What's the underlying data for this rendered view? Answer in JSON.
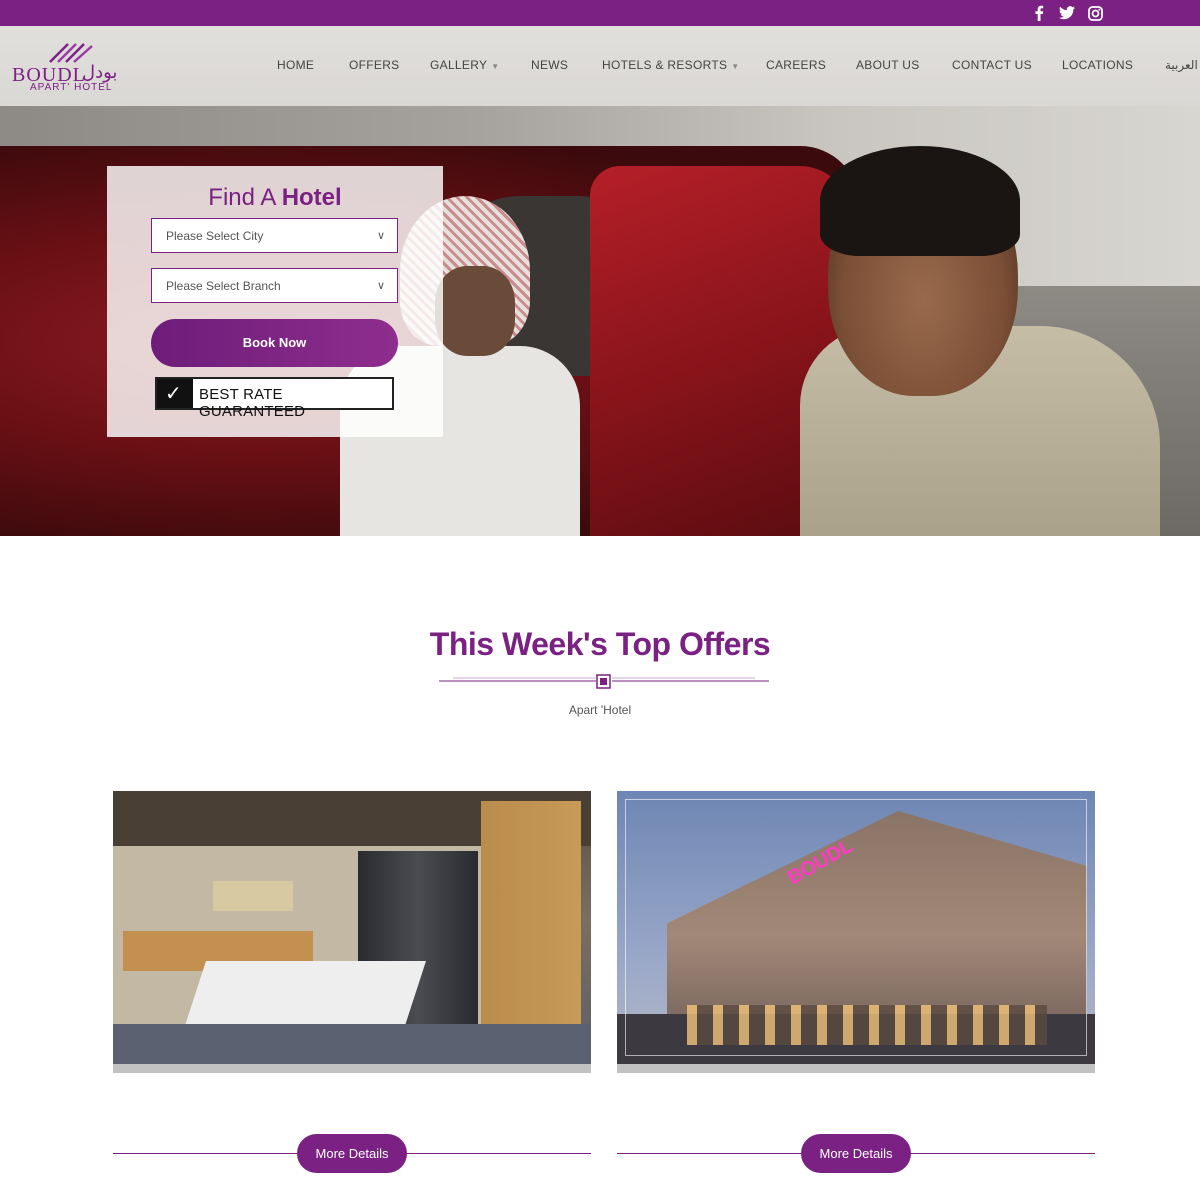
{
  "topbar": {
    "social": [
      {
        "icon": "facebook-icon",
        "glyph": "f"
      },
      {
        "icon": "twitter-icon",
        "glyph": "🐦"
      },
      {
        "icon": "instagram-icon",
        "glyph": "◎"
      }
    ]
  },
  "brand": {
    "name_latin": "BOUDL",
    "name_arabic": "بودل",
    "tagline": "APART' HOTEL",
    "color": "#7a2183"
  },
  "nav": {
    "items": [
      {
        "label": "HOME"
      },
      {
        "label": "OFFERS"
      },
      {
        "label": "GALLERY",
        "has_dropdown": true
      },
      {
        "label": "NEWS"
      },
      {
        "label": "HOTELS & RESORTS",
        "has_dropdown": true
      },
      {
        "label": "CAREERS"
      },
      {
        "label": "ABOUT US"
      },
      {
        "label": "CONTACT US"
      },
      {
        "label": "LOCATIONS"
      },
      {
        "label": "العربية"
      }
    ]
  },
  "find_hotel": {
    "title_light": "Find A",
    "title_bold": "Hotel",
    "city_select": "Please Select City",
    "branch_select": "Please Select Branch",
    "book_button": "Book Now",
    "badge": "BEST RATE GUARANTEED"
  },
  "offers": {
    "title_light": "This Week's",
    "title_bold": "Top Offers",
    "subtitle": "Apart 'Hotel",
    "cards": [
      {
        "image": "hotel-room-photo",
        "button": "More Details"
      },
      {
        "image": "hotel-building-photo",
        "button": "More Details"
      }
    ]
  }
}
